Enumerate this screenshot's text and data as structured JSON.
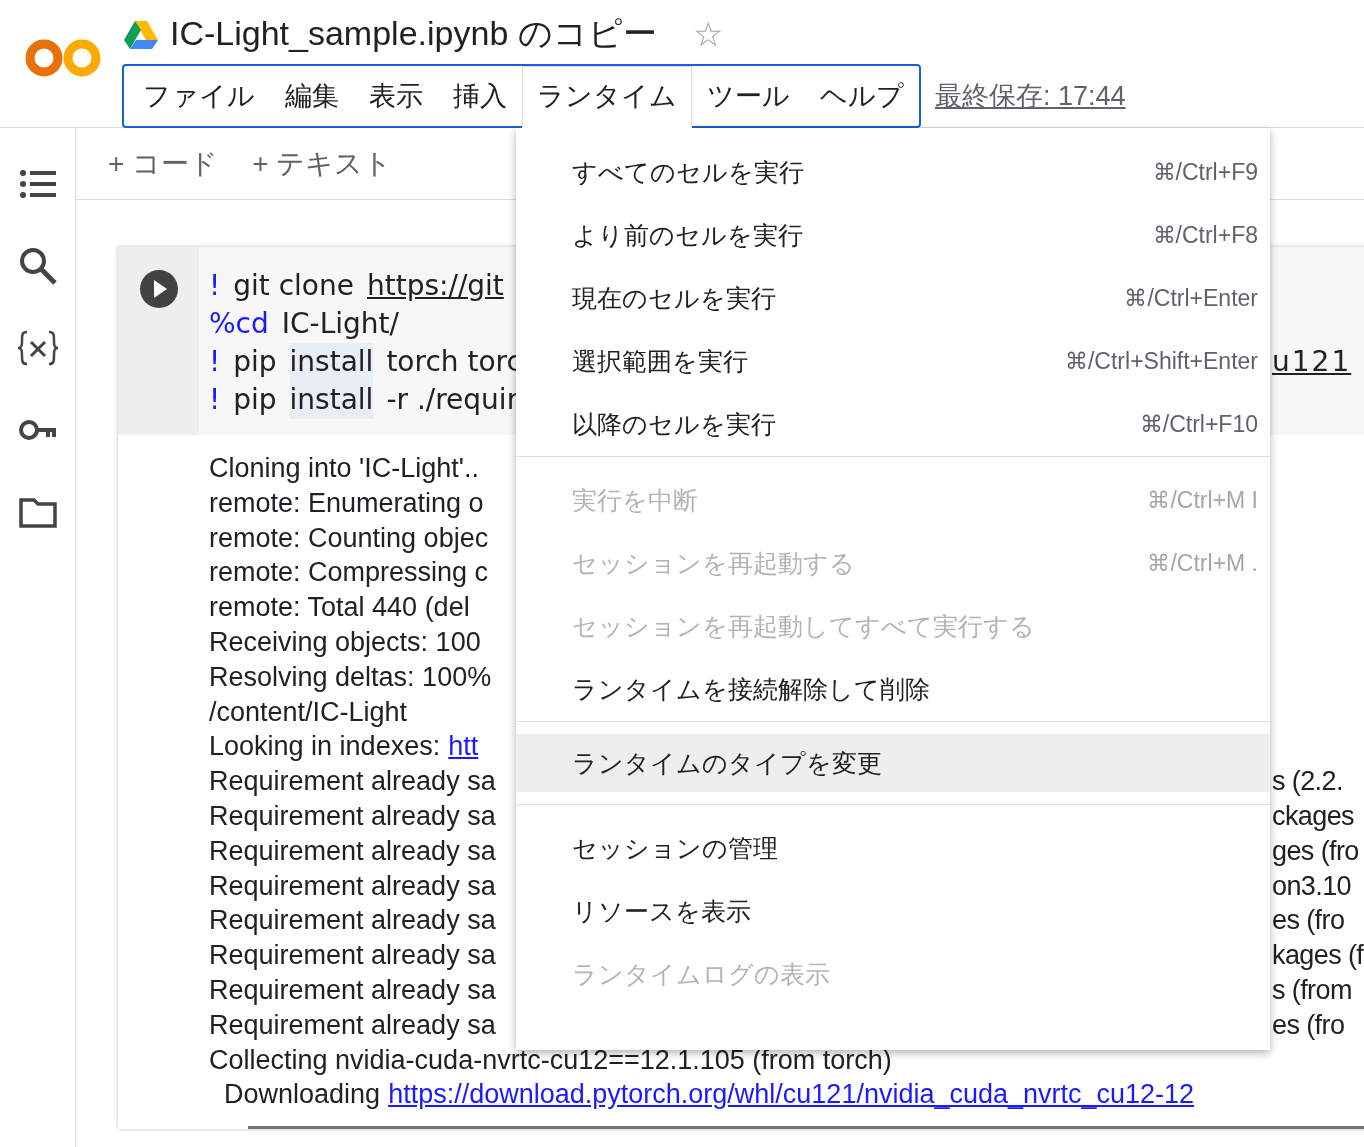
{
  "header": {
    "title": "IC-Light_sample.ipynb のコピー",
    "star": "☆",
    "starred": false,
    "menus": [
      {
        "label": "ファイル",
        "selected": false
      },
      {
        "label": "編集",
        "selected": false
      },
      {
        "label": "表示",
        "selected": false
      },
      {
        "label": "挿入",
        "selected": false
      },
      {
        "label": "ランタイム",
        "selected": true
      },
      {
        "label": "ツール",
        "selected": false
      },
      {
        "label": "ヘルプ",
        "selected": false
      }
    ],
    "last_saved": "最終保存: 17:44"
  },
  "toolbar": [
    {
      "label": "+ コード"
    },
    {
      "label": "+ テキスト"
    }
  ],
  "cell": {
    "code_lines": [
      {
        "tokens": [
          {
            "kind": "magic",
            "text": "!"
          },
          {
            "kind": "plain",
            "text": "git clone"
          },
          {
            "kind": "link",
            "text": "https://git"
          }
        ]
      },
      {
        "tokens": [
          {
            "kind": "magic",
            "text": "%cd"
          },
          {
            "kind": "plain",
            "text": "IC-Light/"
          }
        ]
      },
      {
        "tokens": [
          {
            "kind": "magic",
            "text": "!"
          },
          {
            "kind": "plain",
            "text": "pip"
          },
          {
            "kind": "match",
            "text": "install"
          },
          {
            "kind": "plain",
            "text": "torch torc"
          }
        ],
        "right": "u121"
      },
      {
        "tokens": [
          {
            "kind": "magic",
            "text": "!"
          },
          {
            "kind": "plain",
            "text": "pip"
          },
          {
            "kind": "match",
            "text": "install"
          },
          {
            "kind": "plain",
            "text": "-r ./requir"
          }
        ]
      }
    ],
    "output_lines": [
      {
        "left": "Cloning into 'IC-Light'.."
      },
      {
        "left": "remote: Enumerating o"
      },
      {
        "left": "remote: Counting objec"
      },
      {
        "left": "remote: Compressing c"
      },
      {
        "left": "remote: Total 440 (del"
      },
      {
        "left": "Receiving objects: 100"
      },
      {
        "left": "Resolving deltas: 100%"
      },
      {
        "left": "/content/IC-Light"
      },
      {
        "left": "Looking in indexes:",
        "link": "htt"
      },
      {
        "left": "Requirement already sa",
        "right": "s (2.2."
      },
      {
        "left": "Requirement already sa",
        "right": "ckages"
      },
      {
        "left": "Requirement already sa",
        "right": "ges (fro"
      },
      {
        "left": "Requirement already sa",
        "right": "on3.10"
      },
      {
        "left": "Requirement already sa",
        "right": "es (fro"
      },
      {
        "left": "Requirement already sa",
        "right": "kages (f"
      },
      {
        "left": "Requirement already sa",
        "right": "s (from"
      },
      {
        "left": "Requirement already sa",
        "right": "es (fro"
      },
      {
        "left": "Collecting nvidia-cuda-nvrtc-cu12==12.1.105 (from torch)"
      },
      {
        "left": "  Downloading",
        "link": "https://download.pytorch.org/whl/cu121/nvidia_cuda_nvrtc_cu12-12"
      }
    ]
  },
  "runtime_menu": {
    "sections": [
      [
        {
          "label": "すべてのセルを実行",
          "shortcut": "⌘/Ctrl+F9",
          "disabled": false,
          "highlighted": false
        },
        {
          "label": "より前のセルを実行",
          "shortcut": "⌘/Ctrl+F8",
          "disabled": false,
          "highlighted": false
        },
        {
          "label": "現在のセルを実行",
          "shortcut": "⌘/Ctrl+Enter",
          "disabled": false,
          "highlighted": false
        },
        {
          "label": "選択範囲を実行",
          "shortcut": "⌘/Ctrl+Shift+Enter",
          "disabled": false,
          "highlighted": false
        },
        {
          "label": "以降のセルを実行",
          "shortcut": "⌘/Ctrl+F10",
          "disabled": false,
          "highlighted": false
        }
      ],
      [
        {
          "label": "実行を中断",
          "shortcut": "⌘/Ctrl+M I",
          "disabled": true,
          "highlighted": false
        },
        {
          "label": "セッションを再起動する",
          "shortcut": "⌘/Ctrl+M .",
          "disabled": true,
          "highlighted": false
        },
        {
          "label": "セッションを再起動してすべて実行する",
          "disabled": true,
          "highlighted": false
        },
        {
          "label": "ランタイムを接続解除して削除",
          "disabled": false,
          "highlighted": false
        }
      ],
      [
        {
          "label": "ランタイムのタイプを変更",
          "disabled": false,
          "highlighted": true
        }
      ],
      [
        {
          "label": "セッションの管理",
          "disabled": false,
          "highlighted": false
        },
        {
          "label": "リソースを表示",
          "disabled": false,
          "highlighted": false
        },
        {
          "label": "ランタイムログの表示",
          "disabled": true,
          "highlighted": false
        }
      ]
    ]
  }
}
